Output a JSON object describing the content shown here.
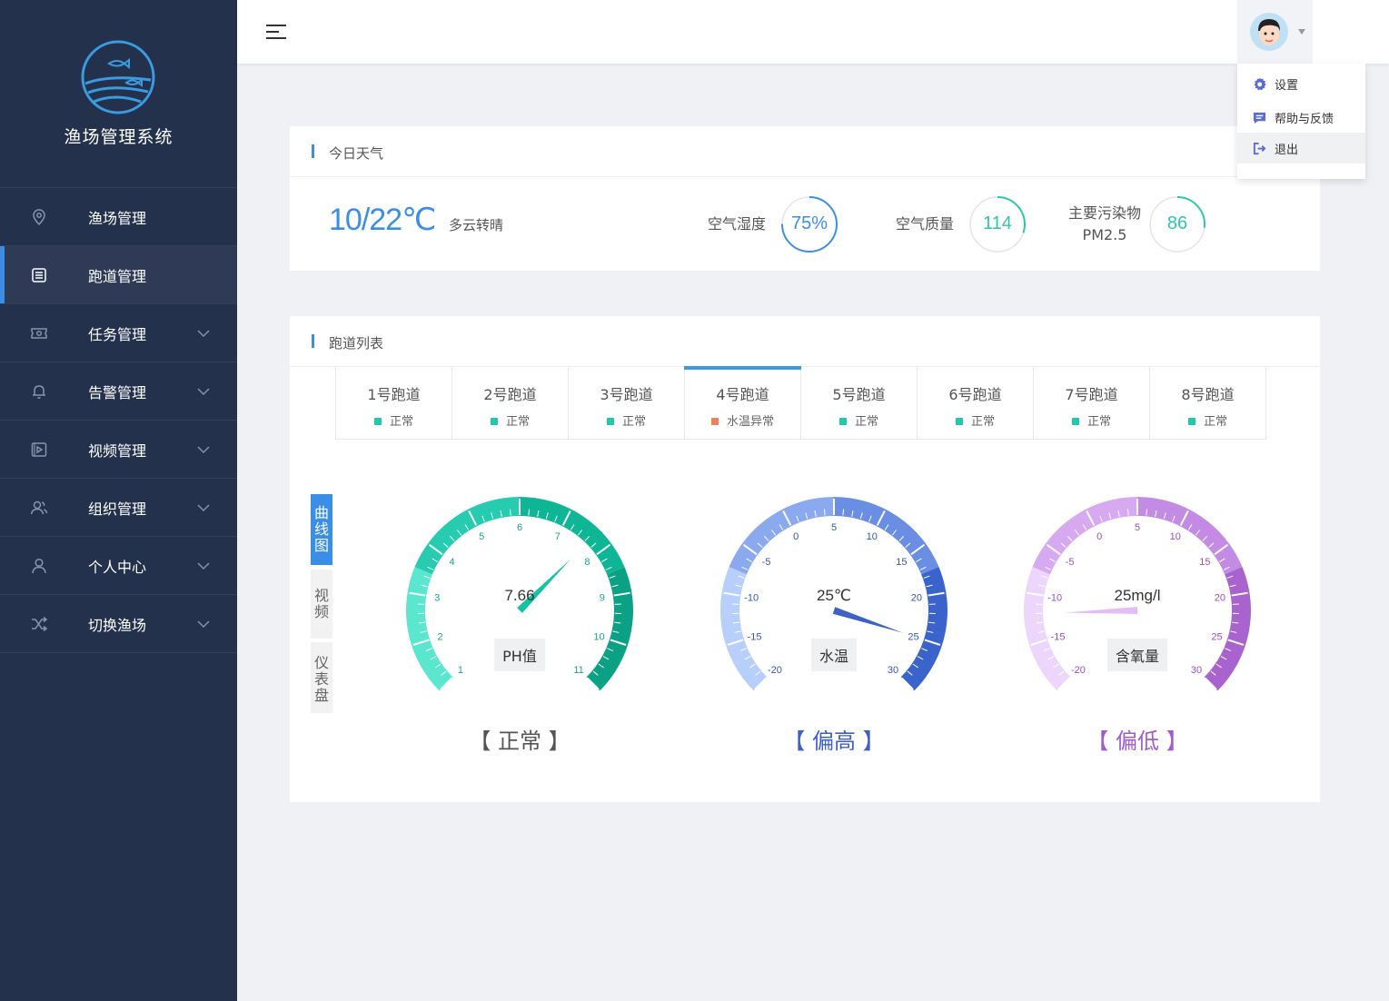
{
  "app": {
    "name": "渔场管理系统"
  },
  "sidebar": {
    "items": [
      {
        "label": "渔场管理",
        "icon": "location-pin-icon",
        "active": false,
        "expandable": false
      },
      {
        "label": "跑道管理",
        "icon": "list-doc-icon",
        "active": true,
        "expandable": false
      },
      {
        "label": "任务管理",
        "icon": "ticket-icon",
        "active": false,
        "expandable": true
      },
      {
        "label": "告警管理",
        "icon": "bell-icon",
        "active": false,
        "expandable": true
      },
      {
        "label": "视频管理",
        "icon": "video-icon",
        "active": false,
        "expandable": true
      },
      {
        "label": "组织管理",
        "icon": "users-icon",
        "active": false,
        "expandable": true
      },
      {
        "label": "个人中心",
        "icon": "user-icon",
        "active": false,
        "expandable": true
      },
      {
        "label": "切换渔场",
        "icon": "shuffle-icon",
        "active": false,
        "expandable": true
      }
    ]
  },
  "user_menu": {
    "items": [
      {
        "label": "设置",
        "icon": "gear-icon"
      },
      {
        "label": "帮助与反馈",
        "icon": "message-icon"
      },
      {
        "label": "退出",
        "icon": "logout-icon"
      }
    ]
  },
  "weather": {
    "title": "今日天气",
    "temperature": "10/22℃",
    "condition": "多云转晴",
    "metrics": [
      {
        "label": "空气湿度",
        "value": "75%",
        "fraction": 0.75,
        "color": "#3a8ee6"
      },
      {
        "label": "空气质量",
        "value": "114",
        "fraction": 0.3,
        "color": "#2ec7a7"
      },
      {
        "label_line1": "主要污染物",
        "label_line2": "PM2.5",
        "value": "86",
        "fraction": 0.27,
        "color": "#2ec7a7"
      }
    ]
  },
  "lanes": {
    "title": "跑道列表",
    "items": [
      {
        "name": "1号跑道",
        "status": "正常",
        "status_color": "#23c9a7"
      },
      {
        "name": "2号跑道",
        "status": "正常",
        "status_color": "#23c9a7"
      },
      {
        "name": "3号跑道",
        "status": "正常",
        "status_color": "#23c9a7"
      },
      {
        "name": "4号跑道",
        "status": "水温异常",
        "status_color": "#f07f5b",
        "active": true
      },
      {
        "name": "5号跑道",
        "status": "正常",
        "status_color": "#23c9a7"
      },
      {
        "name": "6号跑道",
        "status": "正常",
        "status_color": "#23c9a7"
      },
      {
        "name": "7号跑道",
        "status": "正常",
        "status_color": "#23c9a7"
      },
      {
        "name": "8号跑道",
        "status": "正常",
        "status_color": "#23c9a7"
      }
    ]
  },
  "view_tabs": [
    {
      "label": "曲线图",
      "active": true
    },
    {
      "label": "视频",
      "active": false
    },
    {
      "label": "仪表盘",
      "active": false
    }
  ],
  "gauges": [
    {
      "name": "PH值",
      "value": 7.66,
      "value_label": "7.66",
      "min": 1,
      "max": 11,
      "ticks": [
        1,
        2,
        3,
        4,
        5,
        6,
        7,
        8,
        9,
        10,
        11
      ],
      "status": "【 正常 】",
      "status_color": "#555555",
      "colors": [
        "#5be6cf",
        "#26cbb0",
        "#0eb696",
        "#0aa184"
      ],
      "needle": "#12c5a0",
      "text_color": "#1aa48d"
    },
    {
      "name": "水温",
      "value": 25,
      "value_label": "25℃",
      "min": -25,
      "max": 30,
      "ticks": [
        -20,
        -15,
        -10,
        -5,
        0,
        5,
        10,
        15,
        20,
        25,
        30
      ],
      "status": "【 偏高 】",
      "status_color": "#3d5fc7",
      "colors": [
        "#b8cffb",
        "#8aa9ee",
        "#6a8ee4",
        "#3a63cc"
      ],
      "needle": "#3d62c4",
      "text_color": "#3456b8"
    },
    {
      "name": "含氧量",
      "value_label": "25mg/l",
      "value": -12,
      "min": -25,
      "max": 30,
      "ticks": [
        -20,
        -15,
        -10,
        -5,
        0,
        5,
        10,
        15,
        20,
        25,
        30
      ],
      "status": "【 偏低 】",
      "status_color": "#a25ad0",
      "colors": [
        "#ecd6fb",
        "#d6a9f0",
        "#c38be4",
        "#a863cf"
      ],
      "needle": "#e3bdf6",
      "text_color": "#9a4fc7"
    }
  ]
}
